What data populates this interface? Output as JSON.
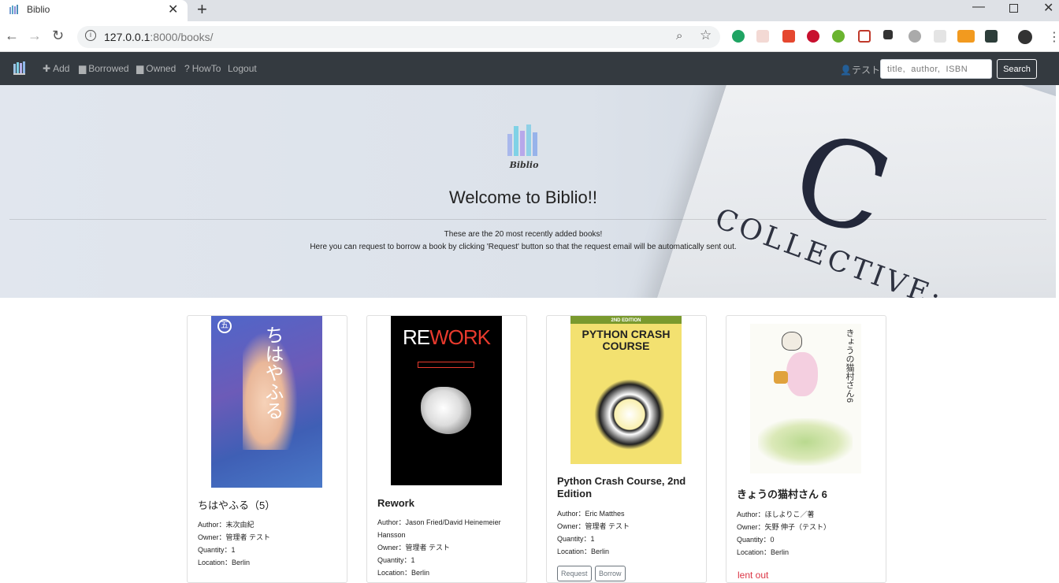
{
  "browser": {
    "tab_title": "Biblio",
    "tab_close": "✕",
    "new_tab": "+",
    "url_host": "127.0.0.1",
    "url_rest": ":8000/books/",
    "window_min": "—",
    "window_close": "✕",
    "extensions_note": "extension-icons"
  },
  "nav": {
    "add": "Add",
    "borrowed": "Borrowed",
    "owned": "Owned",
    "howto": "HowTo",
    "logout": "Logout",
    "user": "テスト",
    "search_placeholder": "title,  author,  ISBN",
    "search_button": "Search"
  },
  "hero": {
    "logo_text": "Biblio",
    "title": "Welcome to Biblio!!",
    "line1": "These are the 20 most recently added books!",
    "line2": "Here you can request to borrow a book by clicking 'Request' button so that the request email will be automatically sent out.",
    "book_text": "COLLECTIVE:"
  },
  "books": [
    {
      "title": "ちはやふる（5）",
      "author": "Author：末次由紀",
      "owner": "Owner：管理者 テスト",
      "quantity": "Quantity：1",
      "location": "Location：Berlin",
      "cover_text": "ちはやふる",
      "cover_color": "#5a6ac2"
    },
    {
      "title": "Rework",
      "author": "Author：Jason Fried/David Heinemeier Hansson",
      "owner": "Owner：管理者 テスト",
      "quantity": "Quantity：1",
      "location": "Location：Berlin",
      "cover_text": "REWORK",
      "cover_color": "#000000"
    },
    {
      "title": "Python Crash Course, 2nd Edition",
      "author": "Author：Eric Matthes",
      "owner": "Owner：管理者 テスト",
      "quantity": "Quantity：1",
      "location": "Location：Berlin",
      "cover_text": "PYTHON CRASH COURSE",
      "cover_edition": "2ND EDITION",
      "cover_color": "#f3e170",
      "request": "Request",
      "borrow": "Borrow"
    },
    {
      "title": "きょうの猫村さん 6",
      "author": "Author：ほしよりこ／著",
      "owner": "Owner：矢野 伸子（テスト）",
      "quantity": "Quantity：0",
      "location": "Location：Berlin",
      "status": "lent out",
      "cover_text": "きょうの猫村さん6",
      "cover_color": "#fbfbf6"
    }
  ]
}
